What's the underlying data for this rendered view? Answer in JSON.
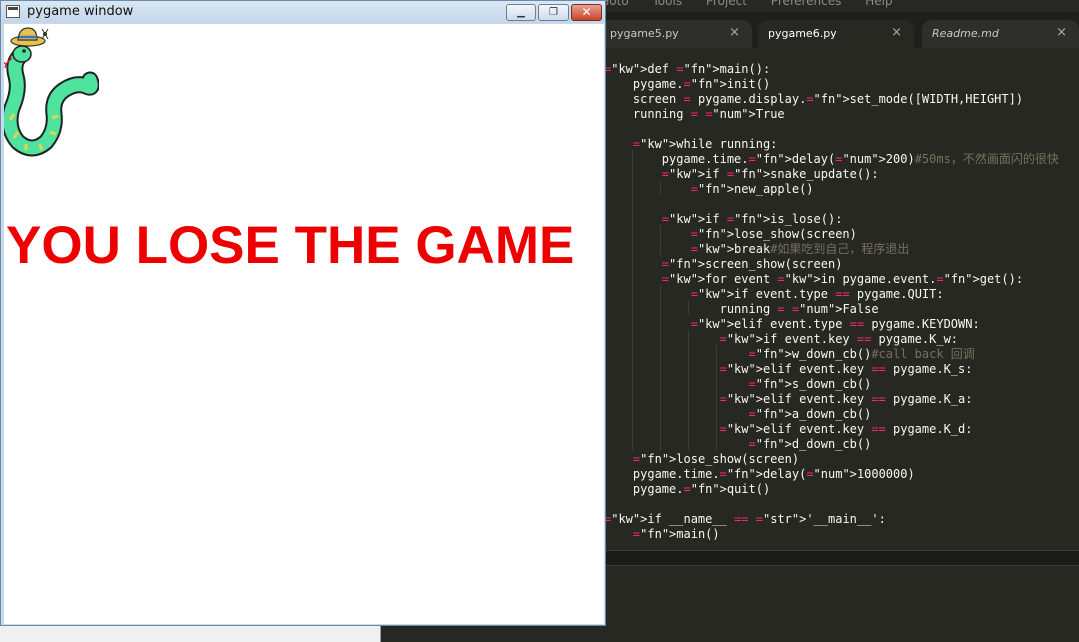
{
  "pygame_window": {
    "title": "pygame window",
    "message": "YOU LOSE THE GAME",
    "buttons": {
      "minimize": "▁",
      "maximize": "❐",
      "close": "✕"
    },
    "message_color": "#ee0000"
  },
  "editor": {
    "menu": [
      "Goto",
      "Tools",
      "Project",
      "Preferences",
      "Help"
    ],
    "tabs": [
      {
        "label": "pygame5.py",
        "active": false
      },
      {
        "label": "pygame6.py",
        "active": true
      },
      {
        "label": "Readme.md",
        "active": false
      }
    ],
    "tab_close": "×",
    "code_lines": [
      "def main():",
      "    pygame.init()",
      "    screen = pygame.display.set_mode([WIDTH,HEIGHT])",
      "    running = True",
      "",
      "    while running:",
      "        pygame.time.delay(200)#50ms，不然画面闪的很快",
      "        if snake_update():",
      "            new_apple()",
      "",
      "        if is_lose():",
      "            lose_show(screen)",
      "            break#如果吃到自己，程序退出",
      "        screen_show(screen)",
      "        for event in pygame.event.get():",
      "            if event.type == pygame.QUIT:",
      "                running = False",
      "            elif event.type == pygame.KEYDOWN:",
      "                if event.key == pygame.K_w:",
      "                    w_down_cb()#call back 回调",
      "                elif event.key == pygame.K_s:",
      "                    s_down_cb()",
      "                elif event.key == pygame.K_a:",
      "                    a_down_cb()",
      "                elif event.key == pygame.K_d:",
      "                    d_down_cb()",
      "    lose_show(screen)",
      "    pygame.time.delay(1000000)",
      "    pygame.quit()",
      "",
      "if __name__ == '__main__':",
      "    main()"
    ],
    "colors": {
      "background": "#272822",
      "keyword": "#f92672",
      "function": "#66d9ef",
      "number": "#ae81ff",
      "string": "#e6db74",
      "comment": "#75715e"
    }
  }
}
